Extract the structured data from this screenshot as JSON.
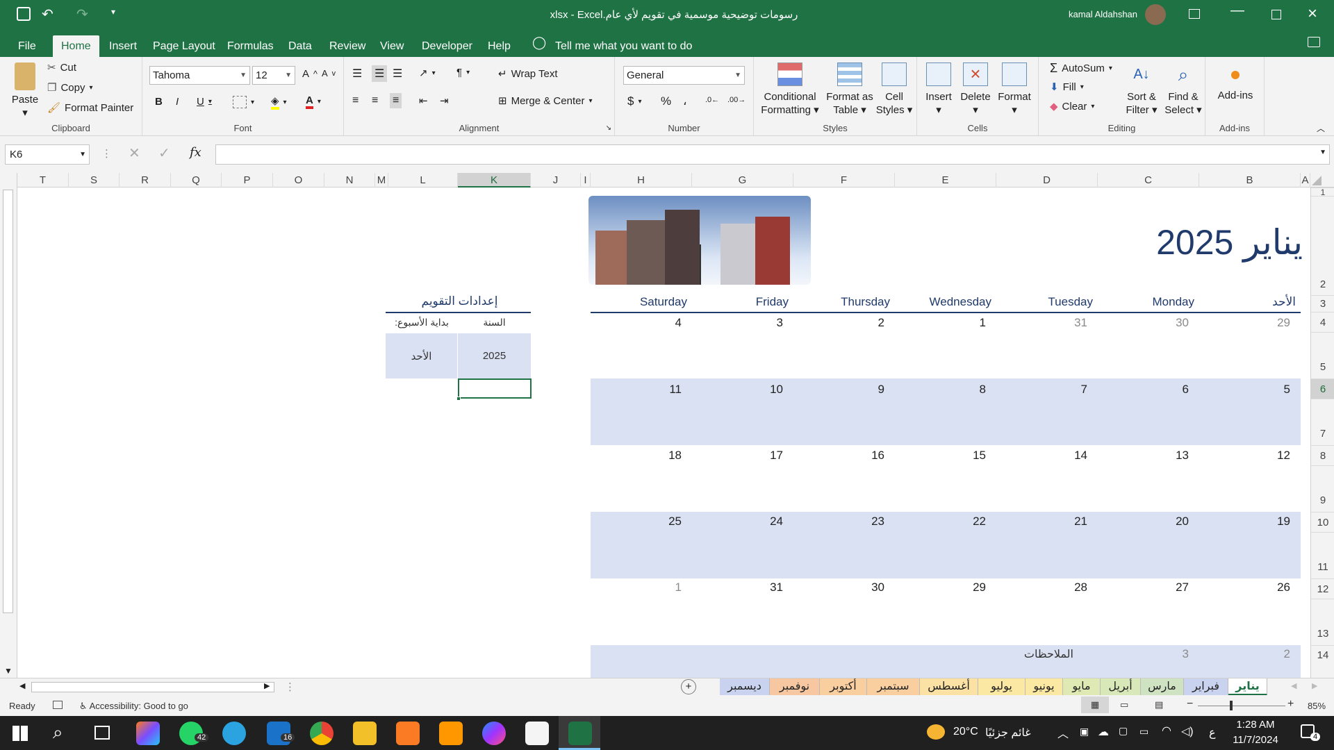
{
  "window": {
    "title": "رسومات توضيحية موسمية في تقويم لأي عام.xlsx  -  Excel",
    "user": "kamal Aldahshan",
    "colors": {
      "excel_green": "#1f7244",
      "band": "#dae1f3",
      "title_blue": "#1f3a6b"
    }
  },
  "ribbon_tabs": [
    "File",
    "Home",
    "Insert",
    "Page Layout",
    "Formulas",
    "Data",
    "Review",
    "View",
    "Developer",
    "Help",
    "Tell me what you want to do"
  ],
  "ribbon": {
    "clipboard": {
      "paste": "Paste",
      "cut": "Cut",
      "copy": "Copy",
      "format_painter": "Format Painter",
      "label": "Clipboard"
    },
    "font": {
      "name": "Tahoma",
      "size": "12",
      "label": "Font"
    },
    "alignment": {
      "wrap": "Wrap Text",
      "merge": "Merge & Center",
      "label": "Alignment"
    },
    "number": {
      "format": "General",
      "label": "Number",
      "currency": "$",
      "percent": "%",
      "comma": "،"
    },
    "styles": {
      "conditional": "Conditional",
      "formatting": "Formatting",
      "format_as": "Format as",
      "table": "Table",
      "cell": "Cell",
      "cell_styles": "Styles",
      "label": "Styles"
    },
    "cells": {
      "insert": "Insert",
      "delete": "Delete",
      "format": "Format",
      "label": "Cells"
    },
    "editing": {
      "autosum": "AutoSum",
      "fill": "Fill",
      "clear": "Clear",
      "sort": "Sort &",
      "filter": "Filter",
      "find": "Find &",
      "select": "Select",
      "label": "Editing"
    },
    "addins": {
      "btn": "Add-ins",
      "label": "Add-ins"
    }
  },
  "formula_bar": {
    "name_box": "K6",
    "fx": "fx",
    "value": ""
  },
  "columns": [
    "T",
    "S",
    "R",
    "Q",
    "P",
    "O",
    "N",
    "M",
    "L",
    "K",
    "J",
    "I",
    "H",
    "G",
    "F",
    "E",
    "D",
    "C",
    "B",
    "A"
  ],
  "rows": [
    "1",
    "2",
    "3",
    "4",
    "5",
    "6",
    "7",
    "8",
    "9",
    "10",
    "11",
    "12",
    "13",
    "14"
  ],
  "calendar": {
    "title": "يناير 2025",
    "days": [
      "الأحد",
      "Monday",
      "Tuesday",
      "Wednesday",
      "Thursday",
      "Friday",
      "Saturday"
    ],
    "weeks": [
      [
        "29",
        "30",
        "31",
        "1",
        "2",
        "3",
        "4"
      ],
      [
        "5",
        "6",
        "7",
        "8",
        "9",
        "10",
        "11"
      ],
      [
        "12",
        "13",
        "14",
        "15",
        "16",
        "17",
        "18"
      ],
      [
        "19",
        "20",
        "21",
        "22",
        "23",
        "24",
        "25"
      ],
      [
        "26",
        "27",
        "28",
        "29",
        "30",
        "31",
        "1"
      ]
    ],
    "notes_label": "الملاحظات",
    "notes_row": [
      "2",
      "3"
    ]
  },
  "settings": {
    "title": "إعدادات التقويم",
    "year_label": "السنة",
    "week_start_label": "بداية الأسبوع:",
    "year_value": "2025",
    "week_start_value": "الأحد"
  },
  "sheet_tabs": [
    {
      "name": "يناير",
      "color": "#dae1f3",
      "active": true
    },
    {
      "name": "فبراير",
      "color": "#c9d3ef"
    },
    {
      "name": "مارس",
      "color": "#cfe3c2"
    },
    {
      "name": "أبريل",
      "color": "#d8e8b8"
    },
    {
      "name": "مايو",
      "color": "#dfe9b3"
    },
    {
      "name": "يونيو",
      "color": "#fbe8a3"
    },
    {
      "name": "يوليو",
      "color": "#fbe8a3"
    },
    {
      "name": "أغسطس",
      "color": "#fbe1a3"
    },
    {
      "name": "سبتمبر",
      "color": "#f9cfa0"
    },
    {
      "name": "أكتوبر",
      "color": "#f9cfa0"
    },
    {
      "name": "نوفمبر",
      "color": "#f6c7a1"
    },
    {
      "name": "ديسمبر",
      "color": "#c9d3ef"
    }
  ],
  "status": {
    "ready": "Ready",
    "accessibility": "Accessibility: Good to go",
    "zoom": "85%"
  },
  "taskbar": {
    "weather_temp": "20°C",
    "weather_text": "غائم جزئيًا",
    "lang": "ع",
    "time": "1:28 AM",
    "date": "11/7/2024",
    "whatsapp_badge": "42",
    "outlook_badge": "16",
    "notif_badge": "4"
  }
}
